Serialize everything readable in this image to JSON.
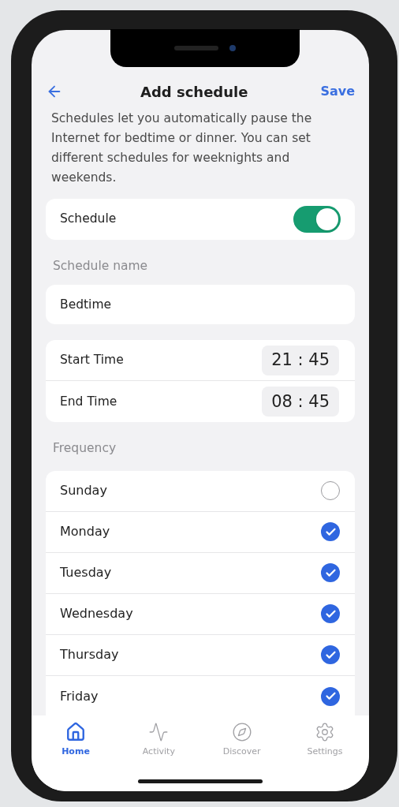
{
  "header": {
    "title": "Add schedule",
    "action": "Save"
  },
  "description": "Schedules let you automatically pause the Internet for bedtime or dinner. You can set different schedules for weeknights and weekends.",
  "schedule_toggle": {
    "label": "Schedule",
    "on": true
  },
  "name_section": {
    "label": "Schedule name",
    "value": "Bedtime"
  },
  "times": [
    {
      "label": "Start Time",
      "value": "21 : 45"
    },
    {
      "label": "End Time",
      "value": "08 : 45"
    }
  ],
  "frequency": {
    "label": "Frequency",
    "days": [
      {
        "label": "Sunday",
        "checked": false
      },
      {
        "label": "Monday",
        "checked": true
      },
      {
        "label": "Tuesday",
        "checked": true
      },
      {
        "label": "Wednesday",
        "checked": true
      },
      {
        "label": "Thursday",
        "checked": true
      },
      {
        "label": "Friday",
        "checked": true
      }
    ]
  },
  "tab_bar": [
    {
      "label": "Home",
      "selected": true
    },
    {
      "label": "Activity",
      "selected": false
    },
    {
      "label": "Discover",
      "selected": false
    },
    {
      "label": "Settings",
      "selected": false
    }
  ]
}
